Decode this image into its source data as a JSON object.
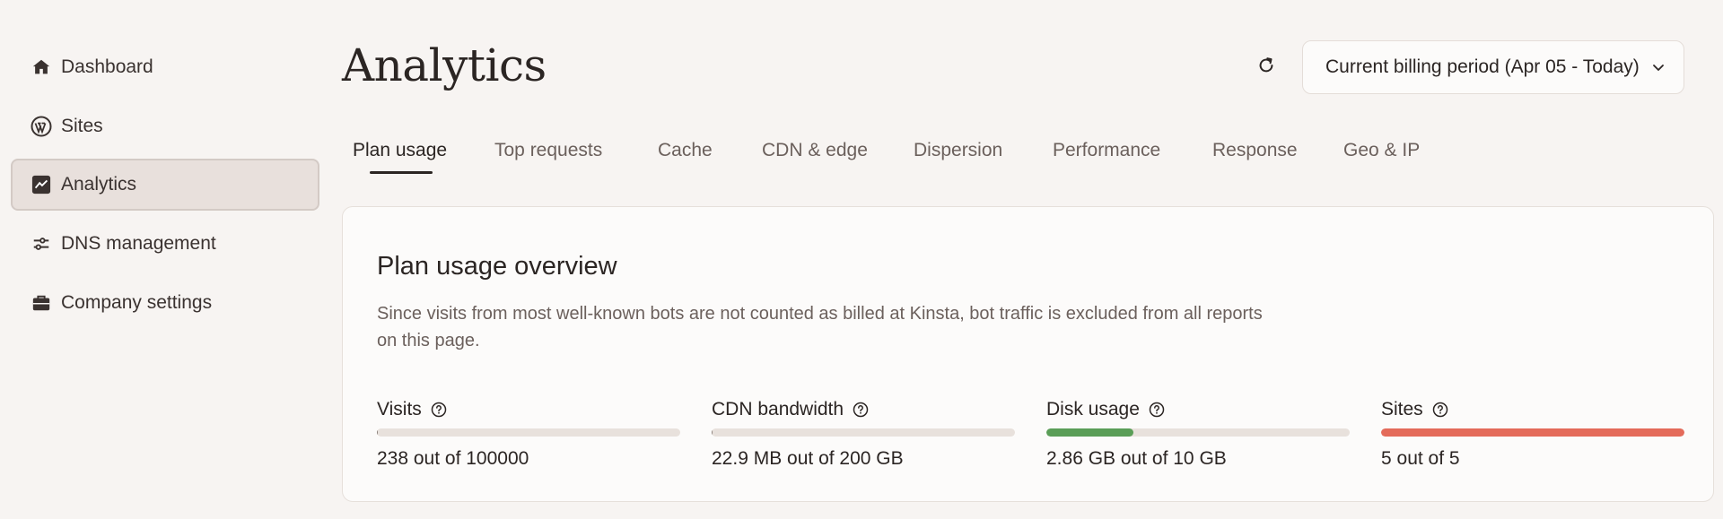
{
  "sidebar": {
    "items": [
      {
        "label": "Dashboard",
        "icon": "home-icon",
        "active": false
      },
      {
        "label": "Sites",
        "icon": "wordpress-icon",
        "active": false
      },
      {
        "label": "Analytics",
        "icon": "chart-icon",
        "active": true
      },
      {
        "label": "DNS management",
        "icon": "dns-icon",
        "active": false
      },
      {
        "label": "Company settings",
        "icon": "briefcase-icon",
        "active": false
      }
    ]
  },
  "header": {
    "title": "Analytics",
    "refresh_icon": "refresh-icon",
    "period_label": "Current billing period (Apr 05 - Today)",
    "period_icon": "chevron-down-icon"
  },
  "tabs": [
    {
      "label": "Plan usage",
      "active": true
    },
    {
      "label": "Top requests",
      "active": false
    },
    {
      "label": "Cache",
      "active": false
    },
    {
      "label": "CDN & edge",
      "active": false
    },
    {
      "label": "Dispersion",
      "active": false
    },
    {
      "label": "Performance",
      "active": false
    },
    {
      "label": "Response",
      "active": false
    },
    {
      "label": "Geo & IP",
      "active": false
    }
  ],
  "card": {
    "title": "Plan usage overview",
    "description": "Since visits from most well-known bots are not counted as billed at Kinsta, bot traffic is excluded from all reports on this page.",
    "metrics": [
      {
        "label": "Visits",
        "value_text": "238 out of 100000",
        "usage_fraction": 0.0024,
        "color": "#8c817c"
      },
      {
        "label": "CDN bandwidth",
        "value_text": "22.9 MB out of 200 GB",
        "usage_fraction": 0.0001,
        "color": "#8c817c"
      },
      {
        "label": "Disk usage",
        "value_text": "2.86 GB out of 10 GB",
        "usage_fraction": 0.286,
        "color": "#5a9e57"
      },
      {
        "label": "Sites",
        "value_text": "5 out of 5",
        "usage_fraction": 1.0,
        "color": "#e46b5a"
      }
    ]
  },
  "colors": {
    "background": "#f7f4f2",
    "card": "#fcfbfa",
    "text": "#2b2523",
    "muted": "#6b605c",
    "active_nav": "#e8e0dc"
  }
}
